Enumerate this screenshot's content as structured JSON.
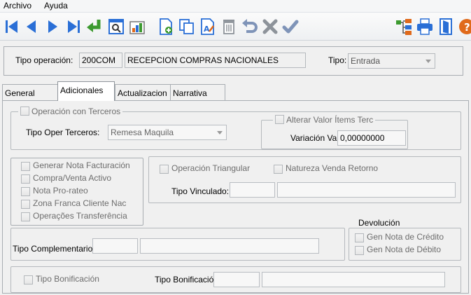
{
  "menu": {
    "items": [
      "Archivo",
      "Ayuda"
    ]
  },
  "toolbar": {
    "icons": [
      "first-record-icon",
      "previous-record-icon",
      "next-record-icon",
      "last-record-icon",
      "enter-icon",
      "search-window-icon",
      "chart-icon",
      "new-document-icon",
      "copy-icon",
      "edit-document-icon",
      "delete-icon",
      "undo-icon",
      "cancel-icon",
      "confirm-icon",
      "tree-icon",
      "print-icon",
      "exit-door-icon",
      "help-icon"
    ]
  },
  "header": {
    "tipo_operacion_label": "Tipo operación:",
    "tipo_operacion_code": "200COM",
    "tipo_operacion_desc": "RECEPCION COMPRAS NACIONALES",
    "tipo_label": "Tipo:",
    "tipo_value": "Entrada"
  },
  "tabs": [
    {
      "label": "General"
    },
    {
      "label": "Adicionales"
    },
    {
      "label": "Actualizacion"
    },
    {
      "label": "Narrativa"
    }
  ],
  "adicionales": {
    "operacion_terceros": "Operación con Terceros",
    "tipo_oper_terceros_label": "Tipo Oper Terceros:",
    "tipo_oper_terceros_value": "Remesa Maquila",
    "alterar_valor": "Alterar Valor Ítems Terc",
    "variacion_label": "Variación Val",
    "variacion_value": "0,00000000",
    "checks_left": [
      "Generar Nota Facturación",
      "Compra/Venta Activo",
      "Nota Pro-rateo",
      "Zona Franca Cliente Nac",
      "Operações Transferência"
    ],
    "operacion_triangular": "Operación Triangular",
    "natureza_venda": "Natureza Venda Retorno",
    "tipo_vinculado_label": "Tipo Vinculado:",
    "devolucion_title": "Devolución",
    "gen_nota_credito": "Gen Nota de Crédito",
    "gen_nota_debito": "Gen Nota de Débito",
    "tipo_complementario_label": "Tipo Complementario:",
    "tipo_bonificacion_check": "Tipo Bonificación",
    "tipo_bonificacion_label": "Tipo Bonificació"
  },
  "colors": {
    "blue": "#2a6fd6",
    "green": "#3c9a2f",
    "orange": "#e06a1b",
    "gray": "#8d939a"
  }
}
